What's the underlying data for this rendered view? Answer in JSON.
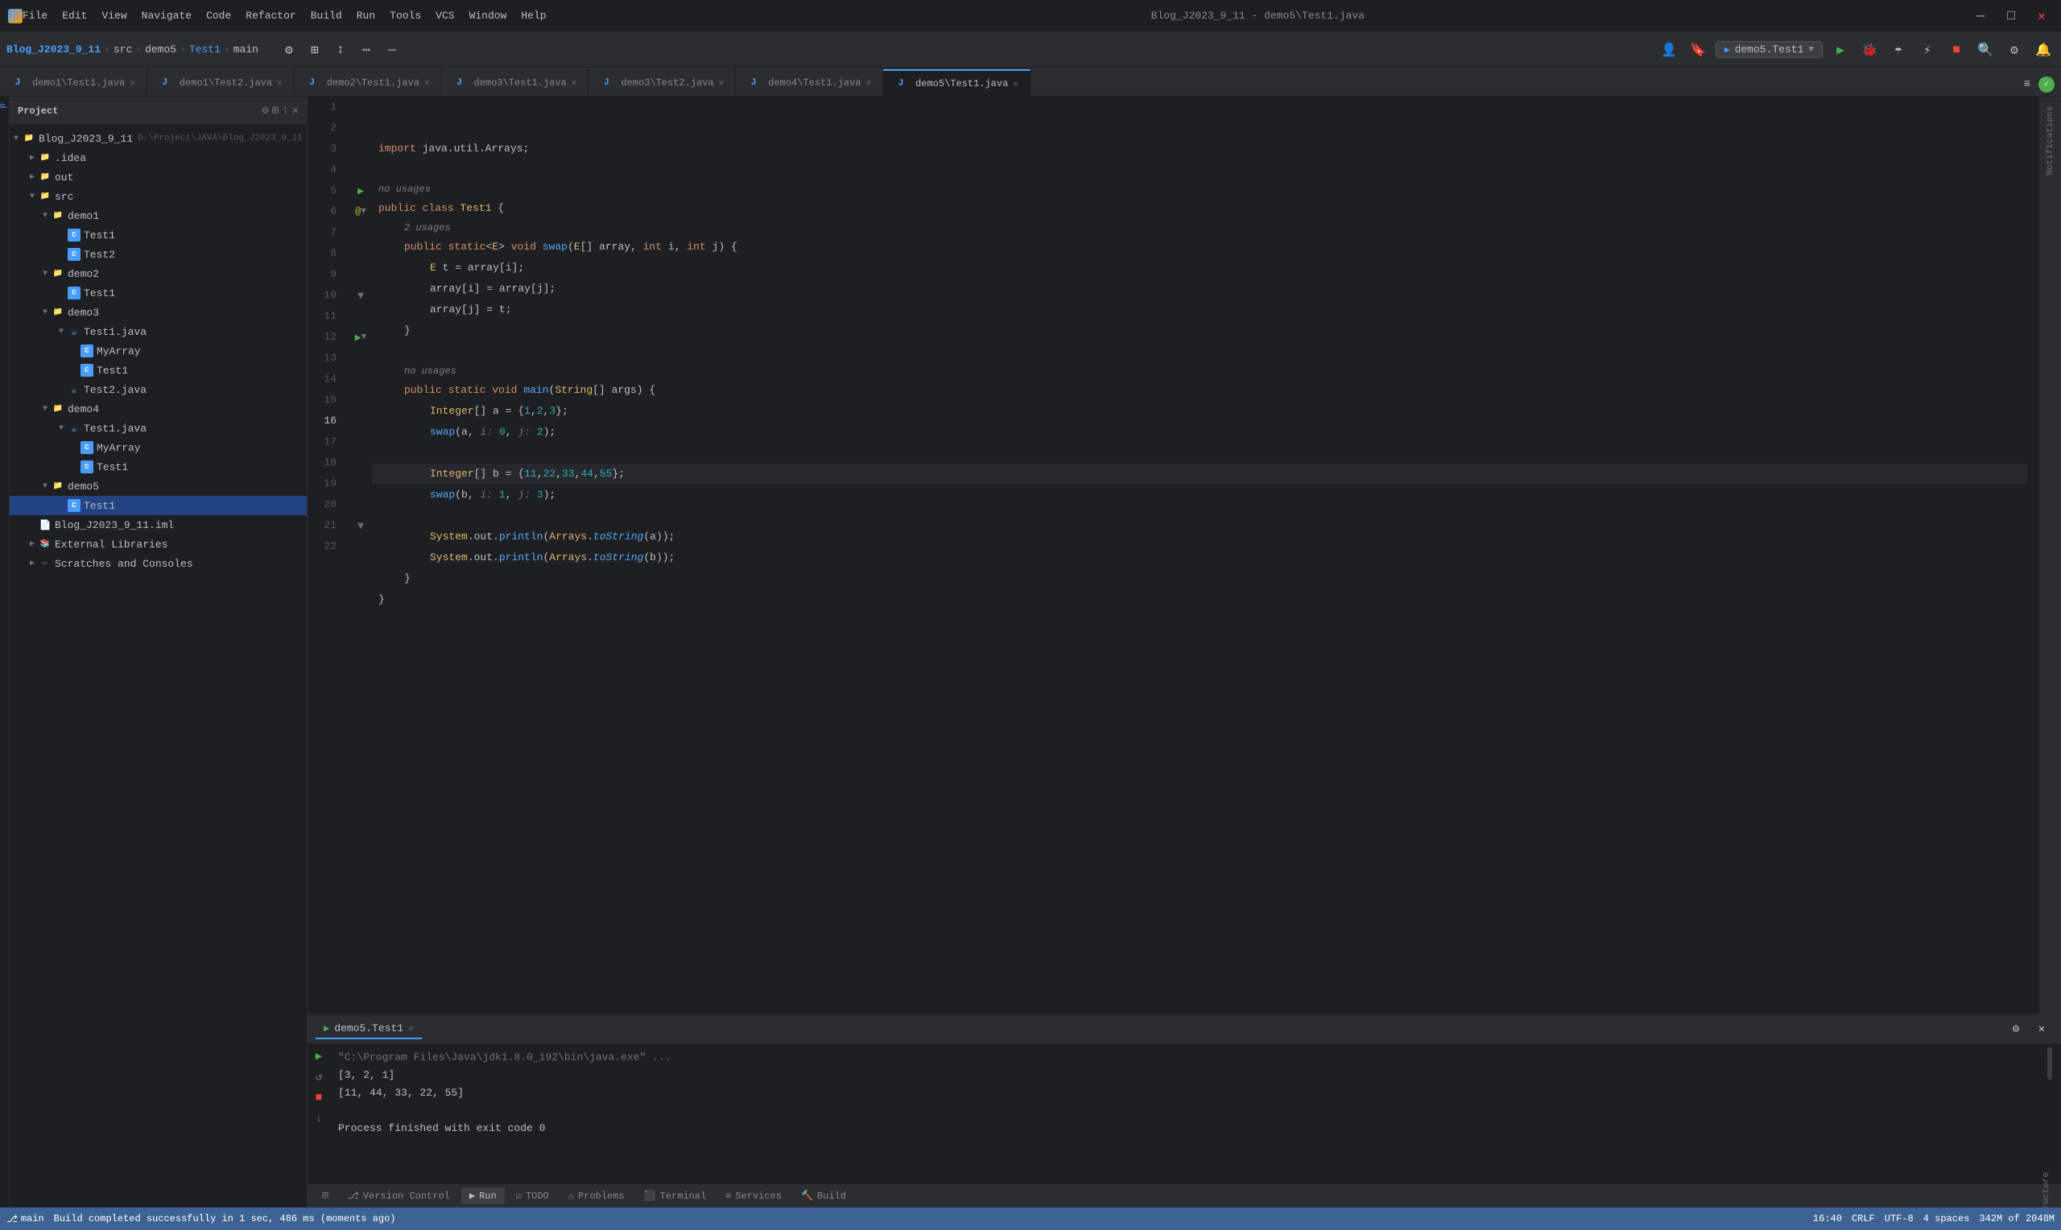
{
  "app": {
    "title": "Blog_J2023_9_11 - demo5\\Test1.java",
    "window_controls": {
      "close": "×",
      "minimize": "—",
      "maximize": "□"
    }
  },
  "menu": {
    "items": [
      "File",
      "Edit",
      "View",
      "Navigate",
      "Code",
      "Refactor",
      "Build",
      "Run",
      "Tools",
      "VCS",
      "Window",
      "Help"
    ]
  },
  "toolbar": {
    "project_name": "Blog_J2023_9_11",
    "src": "src",
    "module": "demo5",
    "file": "Test1",
    "run_config": "demo5.Test1",
    "main_branch": "main"
  },
  "tabs": [
    {
      "label": "demo1\\Test1.java",
      "active": false,
      "icon": "java"
    },
    {
      "label": "demo1\\Test2.java",
      "active": false,
      "icon": "java"
    },
    {
      "label": "demo2\\Test1.java",
      "active": false,
      "icon": "java"
    },
    {
      "label": "demo3\\Test1.java",
      "active": false,
      "icon": "java"
    },
    {
      "label": "demo3\\Test2.java",
      "active": false,
      "icon": "java"
    },
    {
      "label": "demo4\\Test1.java",
      "active": false,
      "icon": "java"
    },
    {
      "label": "demo5\\Test1.java",
      "active": true,
      "icon": "java"
    }
  ],
  "project_tree": {
    "title": "Project",
    "root": "Blog_J2023_9_11",
    "root_path": "D:\\Project\\JAVA\\Blog_J2023_9_11",
    "items": [
      {
        "label": ".idea",
        "type": "folder",
        "depth": 1,
        "expanded": false
      },
      {
        "label": "out",
        "type": "folder",
        "depth": 1,
        "expanded": false
      },
      {
        "label": "src",
        "type": "folder",
        "depth": 1,
        "expanded": true
      },
      {
        "label": "demo1",
        "type": "folder",
        "depth": 2,
        "expanded": true
      },
      {
        "label": "Test1",
        "type": "java-class",
        "depth": 3,
        "expanded": false
      },
      {
        "label": "Test2",
        "type": "java-class",
        "depth": 3,
        "expanded": false
      },
      {
        "label": "demo2",
        "type": "folder",
        "depth": 2,
        "expanded": true
      },
      {
        "label": "Test1",
        "type": "java-class",
        "depth": 3,
        "expanded": false
      },
      {
        "label": "demo3",
        "type": "folder",
        "depth": 2,
        "expanded": true
      },
      {
        "label": "Test1.java",
        "type": "java-file",
        "depth": 3,
        "expanded": false
      },
      {
        "label": "MyArray",
        "type": "java-class",
        "depth": 3,
        "expanded": false
      },
      {
        "label": "Test1",
        "type": "java-class",
        "depth": 3,
        "expanded": false
      },
      {
        "label": "Test2.java",
        "type": "java-file",
        "depth": 3,
        "expanded": false
      },
      {
        "label": "demo4",
        "type": "folder",
        "depth": 2,
        "expanded": true
      },
      {
        "label": "Test1.java",
        "type": "java-file",
        "depth": 3,
        "expanded": false
      },
      {
        "label": "MyArray",
        "type": "java-class",
        "depth": 3,
        "expanded": false
      },
      {
        "label": "Test1",
        "type": "java-class",
        "depth": 3,
        "expanded": false
      },
      {
        "label": "demo5",
        "type": "folder",
        "depth": 2,
        "expanded": true
      },
      {
        "label": "Test1",
        "type": "java-class",
        "depth": 3,
        "expanded": false,
        "selected": true
      },
      {
        "label": "Blog_J2023_9_11.iml",
        "type": "iml-file",
        "depth": 1,
        "expanded": false
      },
      {
        "label": "External Libraries",
        "type": "lib-folder",
        "depth": 1,
        "expanded": false
      },
      {
        "label": "Scratches and Consoles",
        "type": "scratch",
        "depth": 1,
        "expanded": false
      }
    ]
  },
  "code": {
    "lines": [
      {
        "num": 1,
        "content": "",
        "gutter": ""
      },
      {
        "num": 2,
        "content": "",
        "gutter": ""
      },
      {
        "num": 3,
        "content": "import java.util.Arrays;",
        "gutter": ""
      },
      {
        "num": 4,
        "content": "",
        "gutter": ""
      },
      {
        "num": 5,
        "content": "public class Test1 {",
        "gutter": "run",
        "hint": "2 usages",
        "is_hint": false
      },
      {
        "num": 6,
        "content": "    public static<E> void swap(E[] array, int i, int j) {",
        "gutter": "annotate"
      },
      {
        "num": 7,
        "content": "        E t = array[i];",
        "gutter": ""
      },
      {
        "num": 8,
        "content": "        array[i] = array[j];",
        "gutter": ""
      },
      {
        "num": 9,
        "content": "        array[j] = t;",
        "gutter": ""
      },
      {
        "num": 10,
        "content": "    }",
        "gutter": "fold"
      },
      {
        "num": 11,
        "content": "",
        "gutter": ""
      },
      {
        "num": 12,
        "content": "    public static void main(String[] args) {",
        "gutter": "run"
      },
      {
        "num": 13,
        "content": "        Integer[] a = {1,2,3};",
        "gutter": ""
      },
      {
        "num": 14,
        "content": "        swap(a, i: 0, j: 2);",
        "gutter": ""
      },
      {
        "num": 15,
        "content": "",
        "gutter": ""
      },
      {
        "num": 16,
        "content": "        Integer[] b = {11,22,33,44,55};",
        "gutter": ""
      },
      {
        "num": 17,
        "content": "        swap(b, i: 1, j: 3);",
        "gutter": ""
      },
      {
        "num": 18,
        "content": "",
        "gutter": ""
      },
      {
        "num": 19,
        "content": "        System.out.println(Arrays.toString(a));",
        "gutter": ""
      },
      {
        "num": 20,
        "content": "        System.out.println(Arrays.toString(b));",
        "gutter": ""
      },
      {
        "num": 21,
        "content": "    }",
        "gutter": "fold"
      },
      {
        "num": 22,
        "content": "}",
        "gutter": ""
      }
    ]
  },
  "console": {
    "tab_label": "demo5.Test1",
    "output": [
      "\"C:\\Program Files\\Java\\jdk1.8.0_192\\bin\\java.exe\" ...",
      "[3, 2, 1]",
      "[11, 44, 33, 22, 55]",
      "",
      "Process finished with exit code 0"
    ]
  },
  "bottom_tabs": [
    {
      "label": "Version Control",
      "icon": "⎇",
      "active": false
    },
    {
      "label": "Run",
      "icon": "▶",
      "active": true
    },
    {
      "label": "TODO",
      "icon": "☑",
      "active": false
    },
    {
      "label": "Problems",
      "icon": "⚠",
      "active": false
    },
    {
      "label": "Terminal",
      "icon": "⬛",
      "active": false
    },
    {
      "label": "Services",
      "icon": "≡",
      "active": false
    },
    {
      "label": "Build",
      "icon": "🔨",
      "active": false
    }
  ],
  "status_bar": {
    "git": "main",
    "run_label": "Run",
    "version_control": "Version Control",
    "todo": "TODO",
    "problems": "Problems",
    "terminal": "Terminal",
    "build_msg": "Build completed successfully in 1 sec, 486 ms (moments ago)",
    "line_col": "16:40",
    "encoding": "CRLF",
    "charset": "UTF-8",
    "indent": "4 spaces"
  },
  "notifications": {
    "label": "Notifications"
  }
}
